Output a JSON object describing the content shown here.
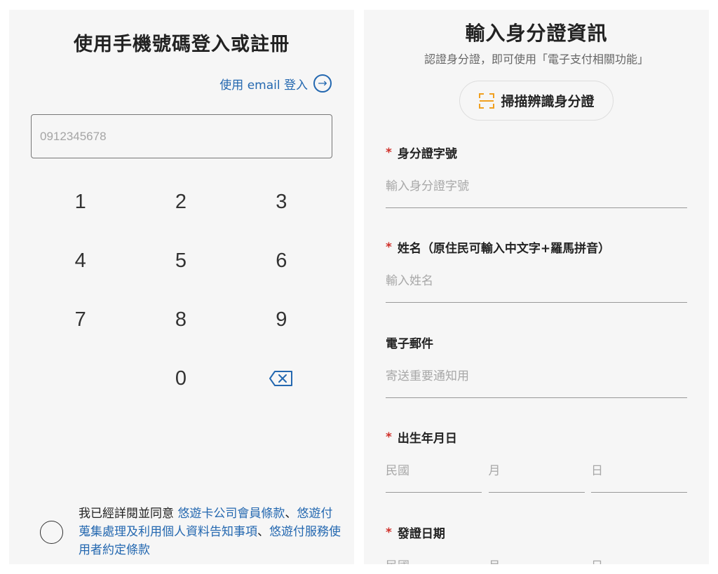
{
  "login": {
    "title": "使用手機號碼登入或註冊",
    "email_link": "使用 email 登入",
    "phone_placeholder": "0912345678",
    "keys": [
      "1",
      "2",
      "3",
      "4",
      "5",
      "6",
      "7",
      "8",
      "9",
      "",
      "0",
      "⌫"
    ],
    "agreement": {
      "prefix": "我已經詳閱並同意 ",
      "terms1": "悠遊卡公司會員條款",
      "sep1": "、",
      "terms2": "悠遊付蒐集處理及利用個人資料告知事項",
      "sep2": "、",
      "terms3": "悠遊付服務使用者約定條款"
    }
  },
  "identity": {
    "title": "輸入身分證資訊",
    "subtitle": "認證身分證，即可使用「電子支付相關功能」",
    "scan_button": "掃描辨識身分證",
    "required_mark": "*",
    "fields": {
      "id_number": {
        "label": "身分證字號",
        "placeholder": "輸入身分證字號"
      },
      "name": {
        "label": "姓名（原住民可輸入中文字+羅馬拼音）",
        "placeholder": "輸入姓名"
      },
      "email": {
        "label": "電子郵件",
        "placeholder": "寄送重要通知用"
      },
      "birth_date": {
        "label": "出生年月日",
        "year": "民國",
        "month": "月",
        "day": "日"
      },
      "issue_date": {
        "label": "發證日期",
        "year": "民國",
        "month": "月",
        "day": "日"
      }
    }
  },
  "colors": {
    "link": "#2468b0",
    "required": "#d0302a",
    "scan_icon": "#f0a020",
    "panel_bg": "#f6f6f6"
  }
}
